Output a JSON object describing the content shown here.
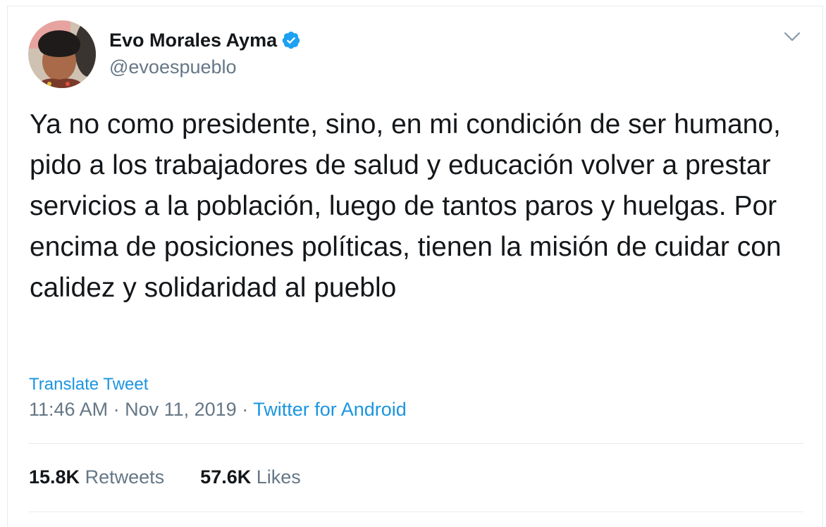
{
  "user": {
    "display_name": "Evo Morales Ayma",
    "handle": "@evoespueblo",
    "verified": true
  },
  "icons": {
    "verified": "verified-badge-icon",
    "menu": "chevron-down-icon"
  },
  "tweet": {
    "text": "Ya no como presidente, sino, en mi condición de ser humano, pido a los trabajadores de salud y educación volver a prestar servicios a la población, luego de tantos paros y huelgas. Por encima de posiciones políticas, tienen la misión de cuidar con calidez y solidaridad al pueblo",
    "translate_label": "Translate Tweet",
    "time": "11:46 AM",
    "date": "Nov 11, 2019",
    "separator": " · ",
    "source": "Twitter for Android"
  },
  "stats": {
    "retweets_count": "15.8K",
    "retweets_label": "Retweets",
    "likes_count": "57.6K",
    "likes_label": "Likes"
  },
  "colors": {
    "text": "#14171a",
    "secondary": "#657786",
    "link": "#1b95e0",
    "border": "#e6ecf0"
  }
}
